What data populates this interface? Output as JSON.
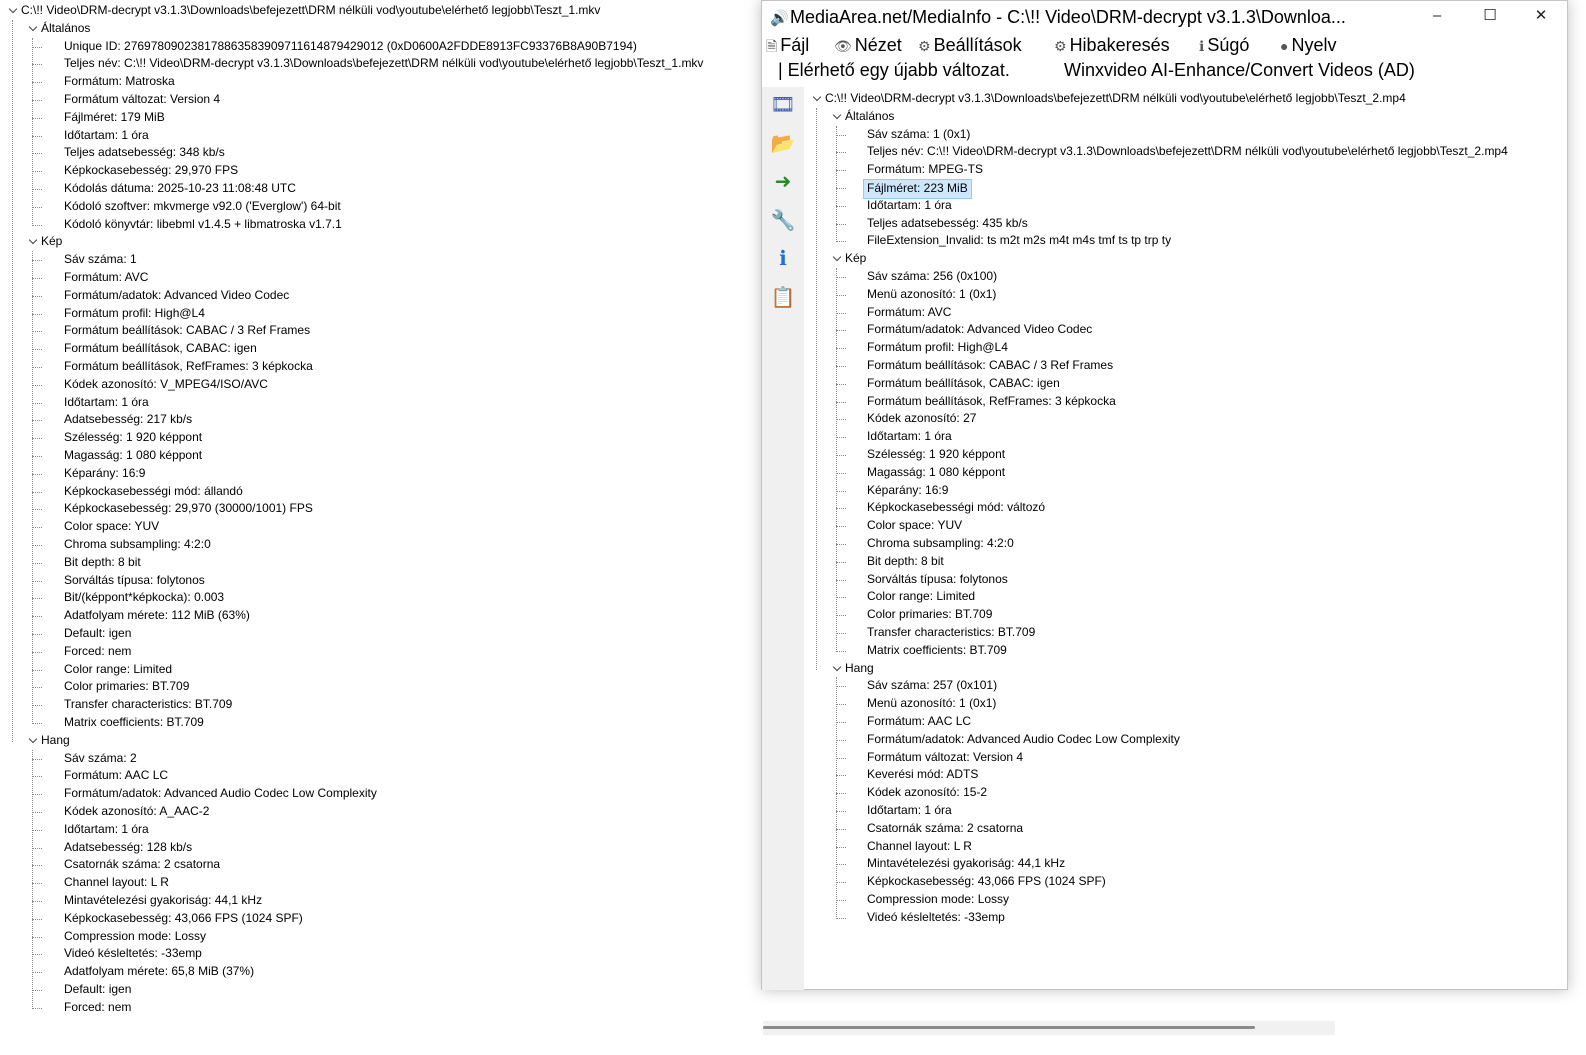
{
  "left": {
    "root": "C:\\!! Video\\DRM-decrypt v3.1.3\\Downloads\\befejezett\\DRM nélküli vod\\youtube\\elérhető legjobb\\Teszt_1.mkv",
    "sections": [
      {
        "title": "Általános",
        "items": [
          "Unique ID: 276978090238178863583909711614879429012 (0xD0600A2FDDE8913FC93376B8A90B7194)",
          "Teljes név: C:\\!! Video\\DRM-decrypt v3.1.3\\Downloads\\befejezett\\DRM nélküli vod\\youtube\\elérhető legjobb\\Teszt_1.mkv",
          "Formátum: Matroska",
          "Formátum változat: Version 4",
          "Fájlméret: 179 MiB",
          "Időtartam: 1 óra",
          "Teljes adatsebesség: 348 kb/s",
          "Képkockasebesség: 29,970 FPS",
          "Kódolás dátuma: 2025-10-23 11:08:48 UTC",
          "Kódoló szoftver: mkvmerge v92.0 ('Everglow') 64-bit",
          "Kódoló könyvtár: libebml v1.4.5 + libmatroska v1.7.1"
        ]
      },
      {
        "title": "Kép",
        "items": [
          "Sáv száma: 1",
          "Formátum: AVC",
          "Formátum/adatok: Advanced Video Codec",
          "Formátum profil: High@L4",
          "Formátum beállítások: CABAC / 3 Ref Frames",
          "Formátum beállítások, CABAC: igen",
          "Formátum beállítások, RefFrames: 3 képkocka",
          "Kódek azonosító: V_MPEG4/ISO/AVC",
          "Időtartam: 1 óra",
          "Adatsebesség: 217 kb/s",
          "Szélesség: 1 920 képpont",
          "Magasság: 1 080 képpont",
          "Képarány: 16:9",
          "Képkockasebességi mód: állandó",
          "Képkockasebesség: 29,970 (30000/1001) FPS",
          "Color space: YUV",
          "Chroma subsampling: 4:2:0",
          "Bit depth: 8 bit",
          "Sorváltás típusa: folytonos",
          "Bit/(képpont*képkocka): 0.003",
          "Adatfolyam mérete: 112 MiB (63%)",
          "Default: igen",
          "Forced: nem",
          "Color range: Limited",
          "Color primaries: BT.709",
          "Transfer characteristics: BT.709",
          "Matrix coefficients: BT.709"
        ]
      },
      {
        "title": "Hang",
        "items": [
          "Sáv száma: 2",
          "Formátum: AAC LC",
          "Formátum/adatok: Advanced Audio Codec Low Complexity",
          "Kódek azonosító: A_AAC-2",
          "Időtartam: 1 óra",
          "Adatsebesség: 128 kb/s",
          "Csatornák száma: 2 csatorna",
          "Channel layout: L R",
          "Mintavételezési gyakoriság: 44,1 kHz",
          "Képkockasebesség: 43,066 FPS (1024 SPF)",
          "Compression mode: Lossy",
          "Videó késleltetés: -33emp",
          "Adatfolyam mérete: 65,8 MiB (37%)",
          "Default: igen",
          "Forced: nem"
        ]
      }
    ]
  },
  "window": {
    "title": "MediaArea.net/MediaInfo - C:\\!! Video\\DRM-decrypt v3.1.3\\Downloa...",
    "minimize": "–",
    "maximize": "☐",
    "close": "✕",
    "menu": [
      "Fájl",
      "Nézet",
      "Beállítások",
      "Hibakeresés",
      "Súgó",
      "Nyelv"
    ],
    "menu_icons": [
      "file-icon",
      "view-icon",
      "settings-icon",
      "debug-icon",
      "help-icon",
      "language-icon"
    ],
    "notice": "| Elérhető egy újabb változat.",
    "ad": "Winxvideo AI-Enhance/Convert Videos (AD)",
    "toolbar_icons": [
      "open-file-icon",
      "open-folder-icon",
      "export-icon",
      "preferences-icon",
      "info-icon",
      "compare-icon"
    ]
  },
  "right": {
    "root": "C:\\!! Video\\DRM-decrypt v3.1.3\\Downloads\\befejezett\\DRM nélküli vod\\youtube\\elérhető legjobb\\Teszt_2.mp4",
    "selected": "Fájlméret: 223 MiB",
    "sections": [
      {
        "title": "Általános",
        "items": [
          "Sáv száma: 1 (0x1)",
          "Teljes név: C:\\!! Video\\DRM-decrypt v3.1.3\\Downloads\\befejezett\\DRM nélküli vod\\youtube\\elérhető legjobb\\Teszt_2.mp4",
          "Formátum: MPEG-TS",
          "Fájlméret: 223 MiB",
          "Időtartam: 1 óra",
          "Teljes adatsebesség: 435 kb/s",
          "FileExtension_Invalid: ts m2t m2s m4t m4s tmf ts tp trp ty"
        ]
      },
      {
        "title": "Kép",
        "items": [
          "Sáv száma: 256 (0x100)",
          "Menü azonosító: 1 (0x1)",
          "Formátum: AVC",
          "Formátum/adatok: Advanced Video Codec",
          "Formátum profil: High@L4",
          "Formátum beállítások: CABAC / 3 Ref Frames",
          "Formátum beállítások, CABAC: igen",
          "Formátum beállítások, RefFrames: 3 képkocka",
          "Kódek azonosító: 27",
          "Időtartam: 1 óra",
          "Szélesség: 1 920 képpont",
          "Magasság: 1 080 képpont",
          "Képarány: 16:9",
          "Képkockasebességi mód: változó",
          "Color space: YUV",
          "Chroma subsampling: 4:2:0",
          "Bit depth: 8 bit",
          "Sorváltás típusa: folytonos",
          "Color range: Limited",
          "Color primaries: BT.709",
          "Transfer characteristics: BT.709",
          "Matrix coefficients: BT.709"
        ]
      },
      {
        "title": "Hang",
        "items": [
          "Sáv száma: 257 (0x101)",
          "Menü azonosító: 1 (0x1)",
          "Formátum: AAC LC",
          "Formátum/adatok: Advanced Audio Codec Low Complexity",
          "Formátum változat: Version 4",
          "Keverési mód: ADTS",
          "Kódek azonosító: 15-2",
          "Időtartam: 1 óra",
          "Csatornák száma: 2 csatorna",
          "Channel layout: L R",
          "Mintavételezési gyakoriság: 44,1 kHz",
          "Képkockasebesség: 43,066 FPS (1024 SPF)",
          "Compression mode: Lossy",
          "Videó késleltetés: -33emp"
        ]
      }
    ]
  }
}
